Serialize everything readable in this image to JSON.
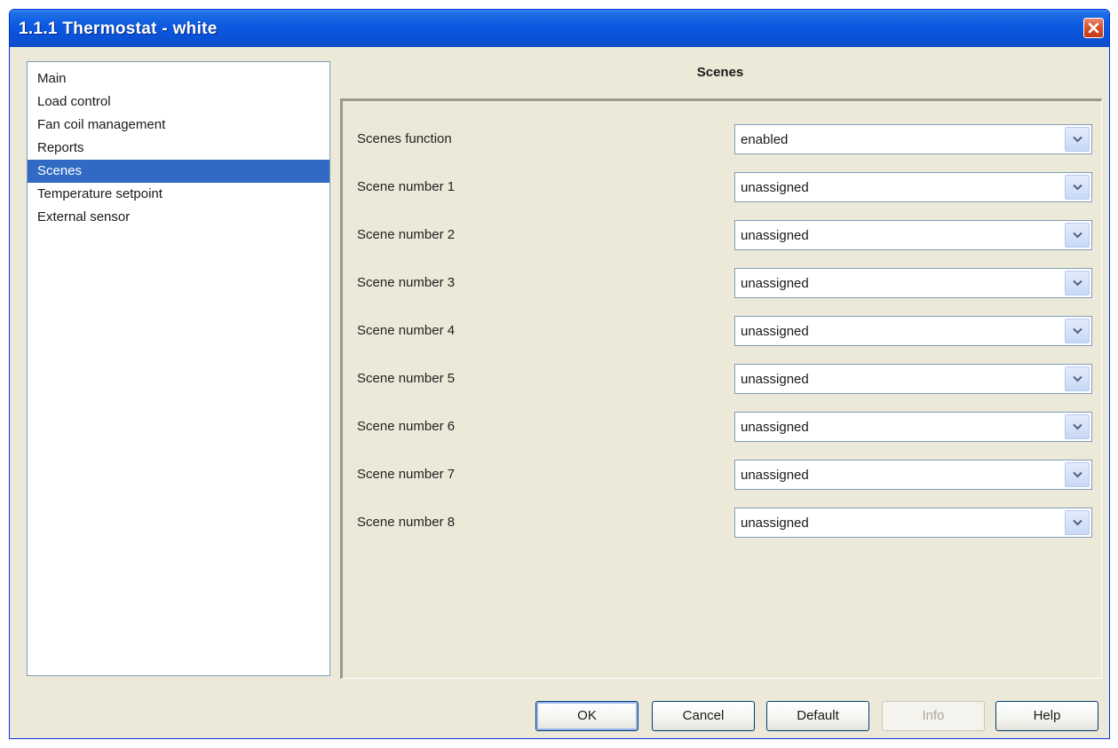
{
  "window": {
    "title": "1.1.1 Thermostat - white"
  },
  "nav": {
    "items": [
      {
        "label": "Main",
        "selected": false
      },
      {
        "label": "Load control",
        "selected": false
      },
      {
        "label": "Fan coil management",
        "selected": false
      },
      {
        "label": "Reports",
        "selected": false
      },
      {
        "label": "Scenes",
        "selected": true
      },
      {
        "label": "Temperature setpoint",
        "selected": false
      },
      {
        "label": "External sensor",
        "selected": false
      }
    ]
  },
  "panel": {
    "title": "Scenes",
    "params": [
      {
        "label": "Scenes function",
        "value": "enabled"
      },
      {
        "label": "Scene number 1",
        "value": "unassigned"
      },
      {
        "label": "Scene number 2",
        "value": "unassigned"
      },
      {
        "label": "Scene number 3",
        "value": "unassigned"
      },
      {
        "label": "Scene number 4",
        "value": "unassigned"
      },
      {
        "label": "Scene number 5",
        "value": "unassigned"
      },
      {
        "label": "Scene number 6",
        "value": "unassigned"
      },
      {
        "label": "Scene number 7",
        "value": "unassigned"
      },
      {
        "label": "Scene number 8",
        "value": "unassigned"
      }
    ]
  },
  "buttons": {
    "ok": "OK",
    "cancel": "Cancel",
    "default": "Default",
    "info": "Info",
    "help": "Help"
  },
  "icons": {
    "close": "close-icon",
    "dropdown": "chevron-down-icon"
  },
  "colors": {
    "selection": "#316ac5",
    "titlebar": "#0a52d8",
    "dialog_bg": "#ece9d8",
    "close_button": "#d9532f"
  }
}
